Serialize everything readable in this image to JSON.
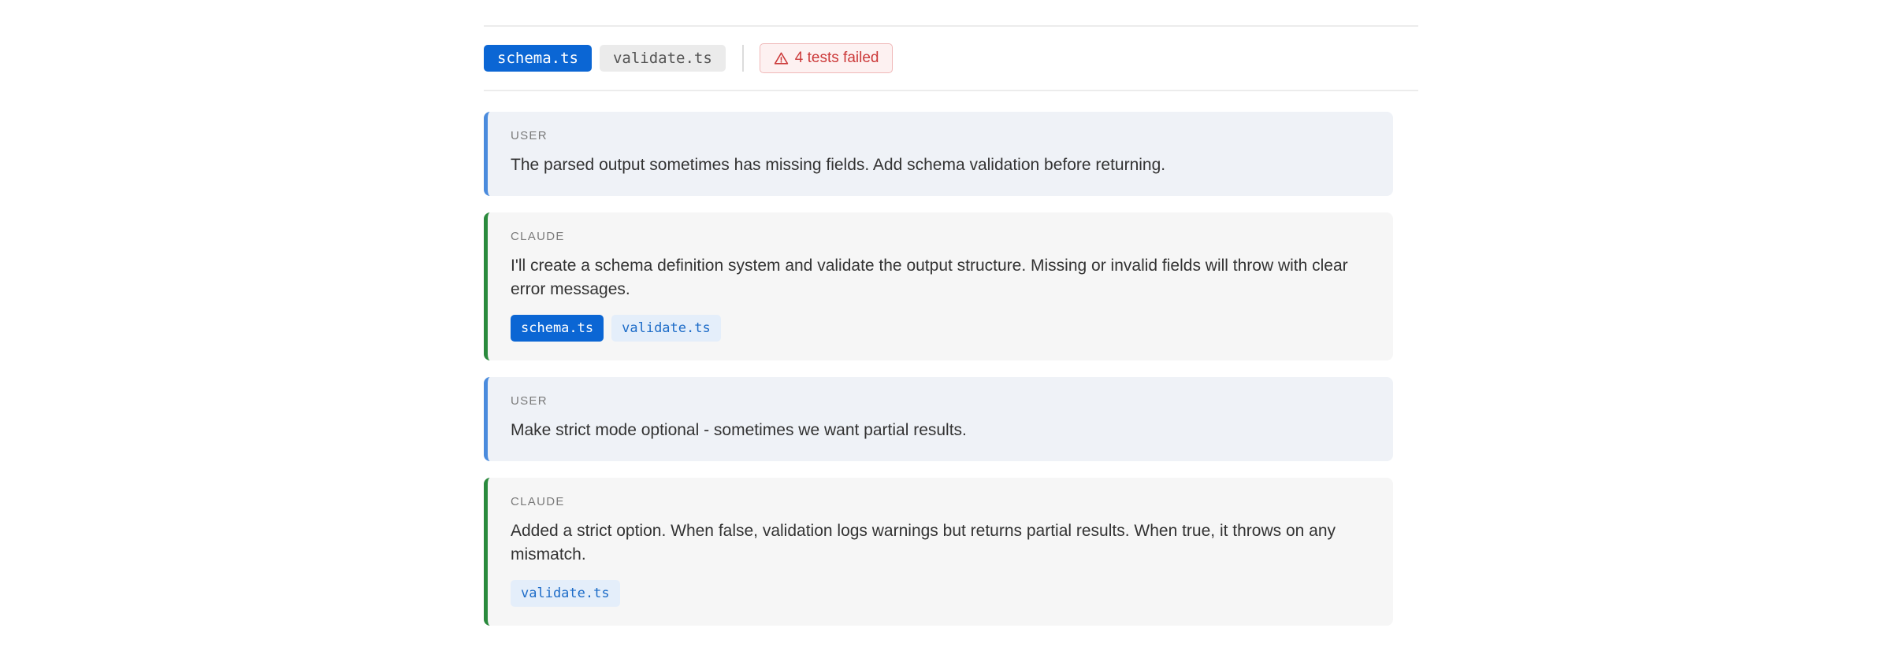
{
  "toolbar": {
    "tabs": [
      {
        "label": "schema.ts",
        "active": true
      },
      {
        "label": "validate.ts",
        "active": false
      }
    ],
    "status": {
      "icon": "warning-triangle-icon",
      "label": "4 tests failed",
      "color": "#cc3a3a"
    }
  },
  "messages": [
    {
      "role": "USER",
      "text": "The parsed output sometimes has missing fields. Add schema validation before returning."
    },
    {
      "role": "CLAUDE",
      "text": "I'll create a schema definition system and validate the output structure. Missing or invalid fields will throw with clear error messages.",
      "files": [
        "schema.ts",
        "validate.ts"
      ]
    },
    {
      "role": "USER",
      "text": "Make strict mode optional - sometimes we want partial results."
    },
    {
      "role": "CLAUDE",
      "text": "Added a strict option. When false, validation logs warnings but returns partial results. When true, it throws on any mismatch.",
      "files": [
        "validate.ts"
      ]
    }
  ],
  "colors": {
    "accent": "#0b66d4",
    "user_border": "#4a8bdd",
    "claude_border": "#2a8a3d",
    "error": "#cc3a3a"
  }
}
